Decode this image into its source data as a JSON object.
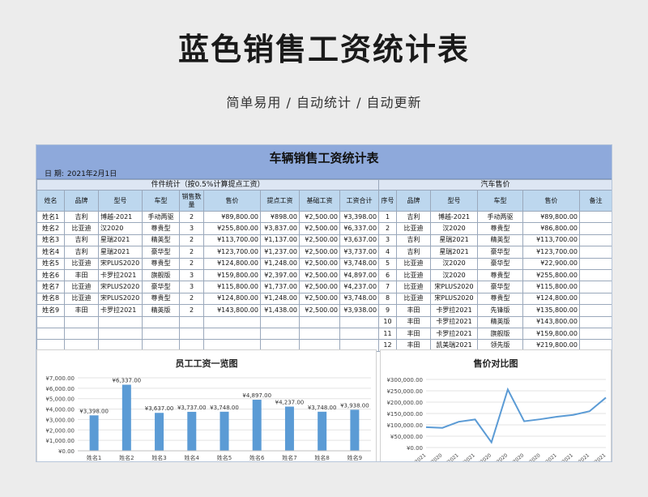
{
  "page": {
    "title": "蓝色销售工资统计表",
    "subtitle": "简单易用 / 自动统计 / 自动更新"
  },
  "sheet": {
    "title": "车辆销售工资统计表",
    "date_label": "日  期:",
    "date_value": "2021年2月1日",
    "left_group": "件件统计（按0.5%计算提点工资）",
    "right_group": "汽车售价",
    "left_headers": [
      "姓名",
      "品牌",
      "型号",
      "车型",
      "销售数量",
      "售价",
      "提点工资",
      "基础工资",
      "工资合计"
    ],
    "right_headers": [
      "序号",
      "品牌",
      "型号",
      "车型",
      "售价",
      "备注"
    ],
    "left_rows": [
      [
        "姓名1",
        "吉利",
        "博越-2021",
        "手动两驱",
        "2",
        "¥89,800.00",
        "¥898.00",
        "¥2,500.00",
        "¥3,398.00"
      ],
      [
        "姓名2",
        "比亚迪",
        "汉2020",
        "尊贵型",
        "3",
        "¥255,800.00",
        "¥3,837.00",
        "¥2,500.00",
        "¥6,337.00"
      ],
      [
        "姓名3",
        "吉利",
        "星瑞2021",
        "精英型",
        "2",
        "¥113,700.00",
        "¥1,137.00",
        "¥2,500.00",
        "¥3,637.00"
      ],
      [
        "姓名4",
        "吉利",
        "星瑞2021",
        "豪华型",
        "2",
        "¥123,700.00",
        "¥1,237.00",
        "¥2,500.00",
        "¥3,737.00"
      ],
      [
        "姓名5",
        "比亚迪",
        "宋PLUS2020",
        "尊贵型",
        "2",
        "¥124,800.00",
        "¥1,248.00",
        "¥2,500.00",
        "¥3,748.00"
      ],
      [
        "姓名6",
        "丰田",
        "卡罗拉2021",
        "旗舰版",
        "3",
        "¥159,800.00",
        "¥2,397.00",
        "¥2,500.00",
        "¥4,897.00"
      ],
      [
        "姓名7",
        "比亚迪",
        "宋PLUS2020",
        "豪华型",
        "3",
        "¥115,800.00",
        "¥1,737.00",
        "¥2,500.00",
        "¥4,237.00"
      ],
      [
        "姓名8",
        "比亚迪",
        "宋PLUS2020",
        "尊贵型",
        "2",
        "¥124,800.00",
        "¥1,248.00",
        "¥2,500.00",
        "¥3,748.00"
      ],
      [
        "姓名9",
        "丰田",
        "卡罗拉2021",
        "精英版",
        "2",
        "¥143,800.00",
        "¥1,438.00",
        "¥2,500.00",
        "¥3,938.00"
      ]
    ],
    "right_rows": [
      [
        "1",
        "吉利",
        "博越-2021",
        "手动两驱",
        "¥89,800.00",
        ""
      ],
      [
        "2",
        "比亚迪",
        "汉2020",
        "尊贵型",
        "¥86,800.00",
        ""
      ],
      [
        "3",
        "吉利",
        "星瑞2021",
        "精英型",
        "¥113,700.00",
        ""
      ],
      [
        "4",
        "吉利",
        "星瑞2021",
        "豪华型",
        "¥123,700.00",
        ""
      ],
      [
        "5",
        "比亚迪",
        "汉2020",
        "豪华型",
        "¥22,900.00",
        ""
      ],
      [
        "6",
        "比亚迪",
        "汉2020",
        "尊贵型",
        "¥255,800.00",
        ""
      ],
      [
        "7",
        "比亚迪",
        "宋PLUS2020",
        "豪华型",
        "¥115,800.00",
        ""
      ],
      [
        "8",
        "比亚迪",
        "宋PLUS2020",
        "尊贵型",
        "¥124,800.00",
        ""
      ],
      [
        "9",
        "丰田",
        "卡罗拉2021",
        "先锋版",
        "¥135,800.00",
        ""
      ],
      [
        "10",
        "丰田",
        "卡罗拉2021",
        "精英版",
        "¥143,800.00",
        ""
      ],
      [
        "11",
        "丰田",
        "卡罗拉2021",
        "旗舰版",
        "¥159,800.00",
        ""
      ],
      [
        "12",
        "丰田",
        "凯美瑞2021",
        "领先版",
        "¥219,800.00",
        ""
      ]
    ]
  },
  "chart_data": [
    {
      "type": "bar",
      "title": "员工工资一览图",
      "categories": [
        "姓名1",
        "姓名2",
        "姓名3",
        "姓名4",
        "姓名5",
        "姓名6",
        "姓名7",
        "姓名8",
        "姓名9"
      ],
      "values": [
        3398,
        6337,
        3637,
        3737,
        3748,
        4897,
        4237,
        3748,
        3938
      ],
      "data_labels": [
        "¥3,398.00",
        "¥6,337.00",
        "¥3,637.00",
        "¥3,737.00",
        "¥3,748.00",
        "¥4,897.00",
        "¥4,237.00",
        "¥3,748.00",
        "¥3,938.00"
      ],
      "y_ticks": [
        "¥7,000.00",
        "¥6,000.00",
        "¥5,000.00",
        "¥4,000.00",
        "¥3,000.00",
        "¥2,000.00",
        "¥1,000.00",
        "¥0.00"
      ],
      "ylim": [
        0,
        7000
      ],
      "grid": true,
      "color": "#5b9bd5"
    },
    {
      "type": "line",
      "title": "售价对比图",
      "categories": [
        "博越-2021",
        "汉2020",
        "星瑞2021",
        "星瑞2021",
        "汉2020",
        "汉2020",
        "宋PLUS2020",
        "宋PLUS2020",
        "卡罗拉2021",
        "卡罗拉2021",
        "卡罗拉2021",
        "凯美瑞2021"
      ],
      "values": [
        89800,
        86800,
        113700,
        123700,
        22900,
        255800,
        115800,
        124800,
        135800,
        143800,
        159800,
        219800
      ],
      "y_ticks": [
        "¥300,000.00",
        "¥250,000.00",
        "¥200,000.00",
        "¥150,000.00",
        "¥100,000.00",
        "¥50,000.00",
        "¥0.00"
      ],
      "ylim": [
        0,
        300000
      ],
      "grid": true,
      "color": "#5b9bd5"
    }
  ]
}
